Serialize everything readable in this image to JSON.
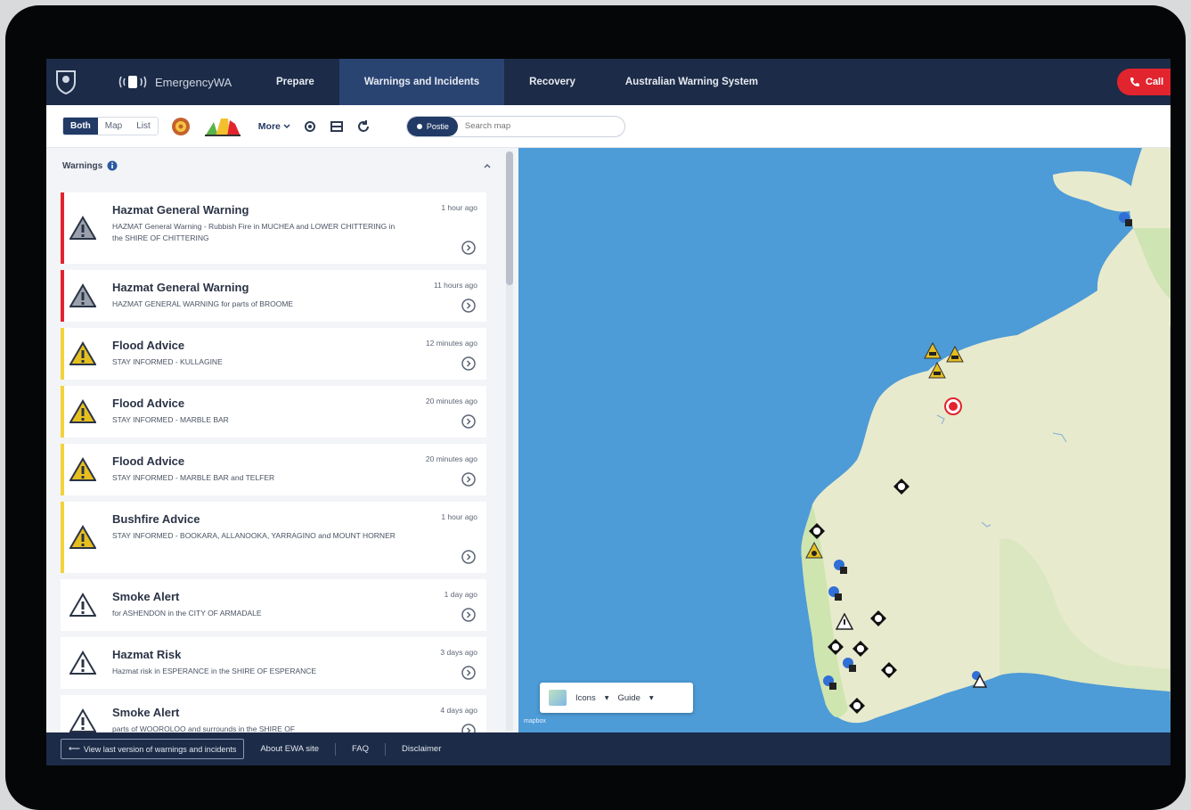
{
  "app": {
    "brand": "EmergencyWA"
  },
  "nav": {
    "items": [
      {
        "label": "Prepare"
      },
      {
        "label": "Warnings and Incidents"
      },
      {
        "label": "Recovery"
      },
      {
        "label": "Australian Warning System"
      }
    ],
    "call_label": "Call"
  },
  "toolbar": {
    "view_modes": [
      "Both",
      "Map",
      "List"
    ],
    "more_label": "More",
    "search_pill": "Postie",
    "search_placeholder": "Search map"
  },
  "sidebar": {
    "heading": "Warnings",
    "items": [
      {
        "title": "Hazmat General Warning",
        "desc": "HAZMAT General Warning - Rubbish Fire in MUCHEA and LOWER CHITTERING in the SHIRE OF CHITTERING",
        "time": "1 hour ago",
        "level": "red"
      },
      {
        "title": "Hazmat General Warning",
        "desc": "HAZMAT GENERAL WARNING for parts of BROOME",
        "time": "11 hours ago",
        "level": "red"
      },
      {
        "title": "Flood Advice",
        "desc": "STAY INFORMED - KULLAGINE",
        "time": "12 minutes ago",
        "level": "yellow"
      },
      {
        "title": "Flood Advice",
        "desc": "STAY INFORMED - MARBLE BAR",
        "time": "20 minutes ago",
        "level": "yellow"
      },
      {
        "title": "Flood Advice",
        "desc": "STAY INFORMED - MARBLE BAR and TELFER",
        "time": "20 minutes ago",
        "level": "yellow"
      },
      {
        "title": "Bushfire Advice",
        "desc": "STAY INFORMED - BOOKARA, ALLANOOKA, YARRAGINO and MOUNT HORNER",
        "time": "1 hour ago",
        "level": "yellow"
      },
      {
        "title": "Smoke Alert",
        "desc": "for ASHENDON in the CITY OF ARMADALE",
        "time": "1 day ago",
        "level": "none"
      },
      {
        "title": "Hazmat Risk",
        "desc": "Hazmat risk in ESPERANCE in the SHIRE OF ESPERANCE",
        "time": "3 days ago",
        "level": "none"
      },
      {
        "title": "Smoke Alert",
        "desc": "parts of WOOROLOO and surrounds in the SHIRE OF",
        "time": "4 days ago",
        "level": "none"
      }
    ]
  },
  "map": {
    "layer_icons_label": "Icons",
    "layer_guide_label": "Guide",
    "attribution": "mapbox"
  },
  "footer": {
    "old_version": "View last version of warnings and incidents",
    "links": [
      "About EWA site",
      "FAQ",
      "Disclaimer"
    ]
  },
  "colors": {
    "nav_bg": "#1c2b47",
    "nav_active": "#2a4472",
    "alert_red": "#e2242e",
    "advice_yellow": "#f3d23a",
    "ocean": "#4d9bd7"
  }
}
